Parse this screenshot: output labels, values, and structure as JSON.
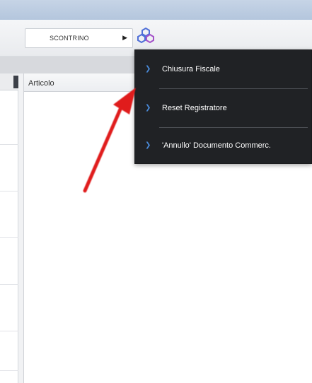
{
  "toolbar": {
    "document_type_value": "SCONTRINO",
    "dropdown_arrow_icon": "triangle-right-icon",
    "fiscal_actions_icon": "cubes-icon"
  },
  "grid": {
    "columns": [
      "Articolo"
    ]
  },
  "fiscal_menu": {
    "items": [
      {
        "label": "Chiusura Fiscale"
      },
      {
        "label": "Reset Registratore"
      },
      {
        "label": "'Annullo' Documento Commerc."
      }
    ]
  },
  "annotation": {
    "arrow_color": "#e01e1e"
  },
  "colors": {
    "menu_background": "#202225",
    "menu_chevron": "#4a8ad8",
    "title_strip": "#bccce2"
  }
}
